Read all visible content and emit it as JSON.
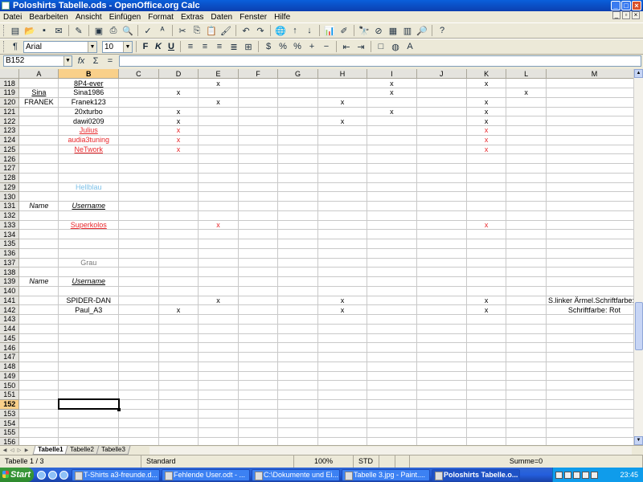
{
  "window": {
    "title": "Poloshirts Tabelle.ods - OpenOffice.org Calc"
  },
  "menu": [
    "Datei",
    "Bearbeiten",
    "Ansicht",
    "Einfügen",
    "Format",
    "Extras",
    "Daten",
    "Fenster",
    "Hilfe"
  ],
  "format_toolbar": {
    "font_name": "Arial",
    "font_size": "10",
    "bold": "F",
    "italic": "K",
    "underline": "U"
  },
  "formula_bar": {
    "cell_ref": "B152",
    "fx": "fx",
    "sum": "Σ",
    "equals": "=",
    "value": ""
  },
  "columns": [
    "A",
    "B",
    "C",
    "D",
    "E",
    "F",
    "G",
    "H",
    "I",
    "J",
    "K",
    "L",
    "M"
  ],
  "selected_column": "B",
  "selected_row": "152",
  "rows": [
    {
      "n": "118",
      "B": "8P4-ever",
      "Bs": "ul",
      "E": "x",
      "I": "x",
      "K": "x"
    },
    {
      "n": "119",
      "A": "Sina",
      "As": "ul",
      "B": "Sina1986",
      "D": "x",
      "I": "x",
      "L": "x"
    },
    {
      "n": "120",
      "A": "FRANEK",
      "B": "Franek123",
      "E": "x",
      "H": "x",
      "K": "x"
    },
    {
      "n": "121",
      "B": "20xturbo",
      "D": "x",
      "I": "x",
      "K": "x"
    },
    {
      "n": "122",
      "B": "dawi0209",
      "D": "x",
      "H": "x",
      "K": "x"
    },
    {
      "n": "123",
      "B": "Julius",
      "Bs": "red-ul",
      "D": "x",
      "Ds": "red",
      "K": "x",
      "Ks": "red"
    },
    {
      "n": "124",
      "B": "audia3tuning",
      "Bs": "red",
      "D": "x",
      "Ds": "red",
      "K": "x",
      "Ks": "red"
    },
    {
      "n": "125",
      "B": "NeTwork",
      "Bs": "red-ul",
      "D": "x",
      "Ds": "red",
      "K": "x",
      "Ks": "red"
    },
    {
      "n": "126"
    },
    {
      "n": "127"
    },
    {
      "n": "128"
    },
    {
      "n": "129",
      "B": "Hellblau",
      "Bs": "hellblau"
    },
    {
      "n": "130"
    },
    {
      "n": "131",
      "A": "Name",
      "As": "italic",
      "B": "Username",
      "Bs": "italic-ul"
    },
    {
      "n": "132"
    },
    {
      "n": "133",
      "B": "Superkolos",
      "Bs": "red-ul",
      "E": "x",
      "Es": "red",
      "K": "x",
      "Ks": "red"
    },
    {
      "n": "134"
    },
    {
      "n": "135"
    },
    {
      "n": "136"
    },
    {
      "n": "137",
      "B": "Grau",
      "Bs": "grau"
    },
    {
      "n": "138"
    },
    {
      "n": "139",
      "A": "Name",
      "As": "italic",
      "B": "Username",
      "Bs": "italic-ul"
    },
    {
      "n": "140"
    },
    {
      "n": "141",
      "B": "SPIDER-DAN",
      "E": "x",
      "H": "x",
      "K": "x",
      "M": "S.linker Ärmel.Schriftfarbe: F",
      "Ms": "right"
    },
    {
      "n": "142",
      "B": "Paul_A3",
      "D": "x",
      "H": "x",
      "K": "x",
      "M": "Schriftfarbe: Rot"
    },
    {
      "n": "143"
    },
    {
      "n": "144"
    },
    {
      "n": "145"
    },
    {
      "n": "146"
    },
    {
      "n": "147"
    },
    {
      "n": "148"
    },
    {
      "n": "149"
    },
    {
      "n": "150"
    },
    {
      "n": "151"
    },
    {
      "n": "152"
    },
    {
      "n": "153"
    },
    {
      "n": "154"
    },
    {
      "n": "155"
    },
    {
      "n": "156"
    }
  ],
  "sheet_tabs": [
    "Tabelle1",
    "Tabelle2",
    "Tabelle3"
  ],
  "active_sheet": "Tabelle1",
  "status": {
    "sheet": "Tabelle 1 / 3",
    "style": "Standard",
    "zoom": "100%",
    "mode": "STD",
    "sum": "Summe=0"
  },
  "taskbar": {
    "start": "Start",
    "tasks": [
      "T-Shirts a3-freunde.d...",
      "Fehlende User.odt - ...",
      "C:\\Dokumente und Ei...",
      "Tabelle 3.jpg - Paint....",
      "Poloshirts Tabelle.o..."
    ],
    "active_task": "Poloshirts Tabelle.o...",
    "clock": "23:45"
  }
}
